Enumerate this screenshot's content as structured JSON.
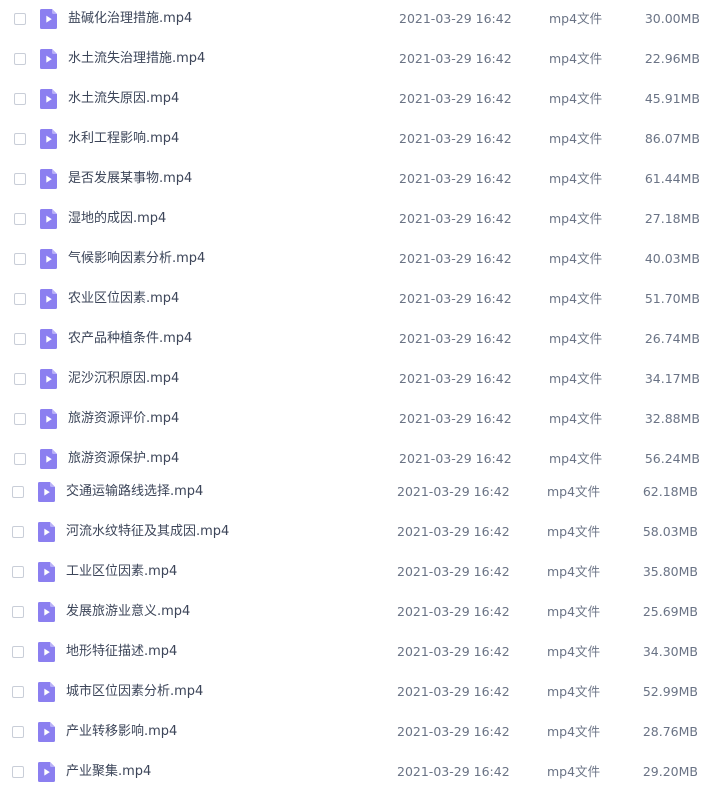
{
  "files": [
    {
      "name": "盐碱化治理措施.mp4",
      "date": "2021-03-29 16:42",
      "type": "mp4文件",
      "size": "30.00MB"
    },
    {
      "name": "水土流失治理措施.mp4",
      "date": "2021-03-29 16:42",
      "type": "mp4文件",
      "size": "22.96MB"
    },
    {
      "name": "水土流失原因.mp4",
      "date": "2021-03-29 16:42",
      "type": "mp4文件",
      "size": "45.91MB"
    },
    {
      "name": "水利工程影响.mp4",
      "date": "2021-03-29 16:42",
      "type": "mp4文件",
      "size": "86.07MB"
    },
    {
      "name": "是否发展某事物.mp4",
      "date": "2021-03-29 16:42",
      "type": "mp4文件",
      "size": "61.44MB"
    },
    {
      "name": "湿地的成因.mp4",
      "date": "2021-03-29 16:42",
      "type": "mp4文件",
      "size": "27.18MB"
    },
    {
      "name": "气候影响因素分析.mp4",
      "date": "2021-03-29 16:42",
      "type": "mp4文件",
      "size": "40.03MB"
    },
    {
      "name": "农业区位因素.mp4",
      "date": "2021-03-29 16:42",
      "type": "mp4文件",
      "size": "51.70MB"
    },
    {
      "name": "农产品种植条件.mp4",
      "date": "2021-03-29 16:42",
      "type": "mp4文件",
      "size": "26.74MB"
    },
    {
      "name": "泥沙沉积原因.mp4",
      "date": "2021-03-29 16:42",
      "type": "mp4文件",
      "size": "34.17MB"
    },
    {
      "name": "旅游资源评价.mp4",
      "date": "2021-03-29 16:42",
      "type": "mp4文件",
      "size": "32.88MB"
    },
    {
      "name": "旅游资源保护.mp4",
      "date": "2021-03-29 16:42",
      "type": "mp4文件",
      "size": "56.24MB"
    },
    {
      "name": "交通运输路线选择.mp4",
      "date": "2021-03-29 16:42",
      "type": "mp4文件",
      "size": "62.18MB"
    },
    {
      "name": "河流水纹特征及其成因.mp4",
      "date": "2021-03-29 16:42",
      "type": "mp4文件",
      "size": "58.03MB"
    },
    {
      "name": "工业区位因素.mp4",
      "date": "2021-03-29 16:42",
      "type": "mp4文件",
      "size": "35.80MB"
    },
    {
      "name": "发展旅游业意义.mp4",
      "date": "2021-03-29 16:42",
      "type": "mp4文件",
      "size": "25.69MB"
    },
    {
      "name": "地形特征描述.mp4",
      "date": "2021-03-29 16:42",
      "type": "mp4文件",
      "size": "34.30MB"
    },
    {
      "name": "城市区位因素分析.mp4",
      "date": "2021-03-29 16:42",
      "type": "mp4文件",
      "size": "52.99MB"
    },
    {
      "name": "产业转移影响.mp4",
      "date": "2021-03-29 16:42",
      "type": "mp4文件",
      "size": "28.76MB"
    },
    {
      "name": "产业聚集.mp4",
      "date": "2021-03-29 16:42",
      "type": "mp4文件",
      "size": "29.20MB"
    }
  ],
  "icons": {
    "file": "video-file-icon",
    "checkbox": "checkbox"
  },
  "colors": {
    "icon_fill": "#8b7ff0",
    "icon_play": "#ffffff",
    "text_primary": "#3c4559",
    "text_secondary": "#6a7385",
    "checkbox_border": "#c9ced8"
  }
}
